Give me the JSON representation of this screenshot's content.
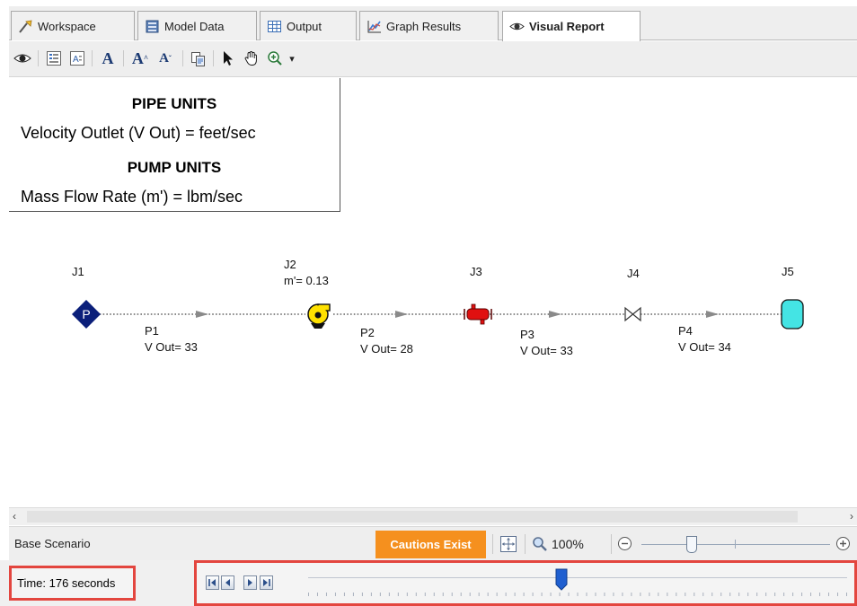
{
  "tabs": [
    {
      "label": "Workspace",
      "icon": "workspace-icon"
    },
    {
      "label": "Model Data",
      "icon": "model-data-icon"
    },
    {
      "label": "Output",
      "icon": "output-table-icon"
    },
    {
      "label": "Graph Results",
      "icon": "graph-icon"
    },
    {
      "label": "Visual Report",
      "icon": "eye-icon",
      "active": true
    }
  ],
  "toolbar": {
    "font_a": "A",
    "font_grow": "A",
    "font_shrink": "A",
    "zoom_dropdown": "▾"
  },
  "units_box": {
    "pipe_heading": "PIPE UNITS",
    "pipe_line": "Velocity Outlet (V Out) = feet/sec",
    "pump_heading": "PUMP UNITS",
    "pump_line": "Mass Flow Rate (m') = lbm/sec"
  },
  "diagram": {
    "junctions": [
      {
        "id": "J1",
        "symbol": "P",
        "type": "assigned-pressure"
      },
      {
        "id": "J2",
        "type": "pump",
        "result": "m'= 0.13"
      },
      {
        "id": "J3",
        "type": "heat-exchanger"
      },
      {
        "id": "J4",
        "type": "valve"
      },
      {
        "id": "J5",
        "type": "tank"
      }
    ],
    "pipes": [
      {
        "id": "P1",
        "result": "V Out= 33"
      },
      {
        "id": "P2",
        "result": "V Out= 28"
      },
      {
        "id": "P3",
        "result": "V Out= 33"
      },
      {
        "id": "P4",
        "result": "V Out= 34"
      }
    ]
  },
  "status": {
    "scenario": "Base Scenario",
    "cautions": "Cautions Exist",
    "zoom": "100%"
  },
  "time": {
    "label": "Time: 176 seconds",
    "slider_fraction": 0.47
  },
  "colors": {
    "cautions_bg": "#f5901e",
    "highlight_border": "#e3463f",
    "junction_pressure": "#0b1f7a",
    "pump": "#ffe100",
    "heat_exchanger": "#e01010",
    "tank": "#44e4e4",
    "slider_thumb": "#1f5fd0"
  }
}
